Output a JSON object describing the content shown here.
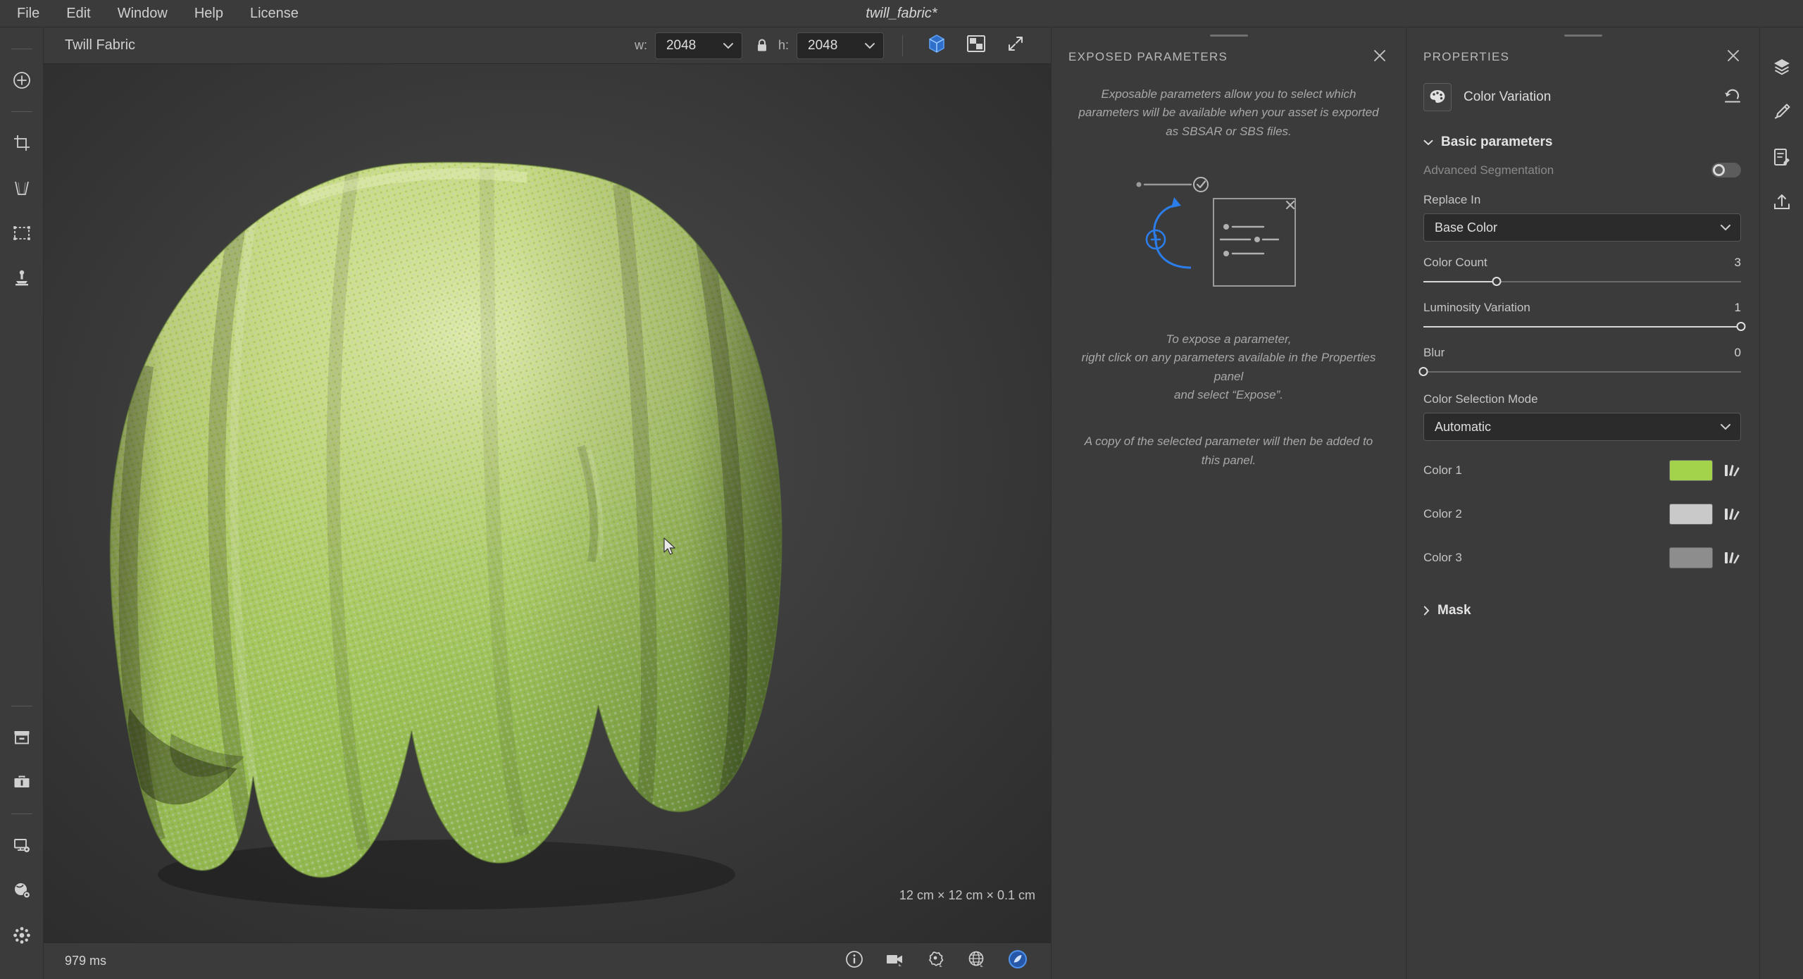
{
  "menubar": {
    "items": [
      "File",
      "Edit",
      "Window",
      "Help",
      "License"
    ],
    "document_title": "twill_fabric*"
  },
  "left_toolbar": {
    "tools": [
      {
        "name": "add-node-tool",
        "icon": "plus-circle-icon"
      },
      {
        "name": "crop-tool",
        "icon": "crop-icon"
      },
      {
        "name": "perspective-tool",
        "icon": "perspective-icon"
      },
      {
        "name": "selection-tool",
        "icon": "selection-box-icon"
      },
      {
        "name": "clone-stamp-tool",
        "icon": "clone-stamp-icon"
      },
      {
        "name": "library-tool",
        "icon": "archive-box-icon"
      },
      {
        "name": "toolbox-tool",
        "icon": "toolbox-icon"
      },
      {
        "name": "display-settings-tool",
        "icon": "monitor-gear-icon"
      },
      {
        "name": "environment-settings-tool",
        "icon": "sphere-gear-icon"
      },
      {
        "name": "plugins-tool",
        "icon": "hub-icon"
      }
    ]
  },
  "viewport": {
    "tab_label": "Twill Fabric",
    "width_label": "w:",
    "width_value": "2048",
    "height_label": "h:",
    "height_value": "2048",
    "lock_icon": "lock-closed-icon",
    "mode_3d_icon": "cube-3d-icon",
    "mode_2d_icon": "checkerboard-2d-icon",
    "expand_icon": "expand-arrows-icon",
    "dimensions": "12 cm × 12 cm × 0.1 cm",
    "accent_color": "#3b7fd4"
  },
  "statusbar": {
    "render_time": "979 ms",
    "icons": [
      {
        "name": "info-icon"
      },
      {
        "name": "camera-icon"
      },
      {
        "name": "material-icon"
      },
      {
        "name": "environment-icon"
      },
      {
        "name": "tonemapping-icon"
      }
    ]
  },
  "exposed_parameters": {
    "title": "EXPOSED PARAMETERS",
    "close_icon": "close-icon",
    "description": "Exposable parameters allow you to select which parameters will be available when your asset is exported as SBSAR or SBS files.",
    "hint_1": "To expose a parameter,\nright click on any parameters available in the Properties panel\nand select “Expose”.",
    "hint_2": "A copy of the selected parameter will then be added to this panel.",
    "illustration_accent": "#2b7de9"
  },
  "properties": {
    "title": "PROPERTIES",
    "close_icon": "close-icon",
    "node_icon": "color-palette-icon",
    "node_name": "Color Variation",
    "reset_icon": "reset-arrow-icon",
    "sections": {
      "basic": {
        "label": "Basic parameters",
        "expanded": true,
        "advanced_segmentation": {
          "label": "Advanced Segmentation",
          "enabled": false,
          "disabled": true
        },
        "replace_in": {
          "label": "Replace In",
          "value": "Base Color"
        },
        "sliders": [
          {
            "label": "Color Count",
            "value": "3",
            "percent": 23
          },
          {
            "label": "Luminosity Variation",
            "value": "1",
            "percent": 100
          },
          {
            "label": "Blur",
            "value": "0",
            "percent": 0
          }
        ],
        "color_selection_mode": {
          "label": "Color Selection Mode",
          "value": "Automatic"
        },
        "colors": [
          {
            "label": "Color 1",
            "hex": "#a3d24b",
            "picker_icon": "color-picker-icon"
          },
          {
            "label": "Color 2",
            "hex": "#c9c9c9",
            "picker_icon": "color-picker-icon"
          },
          {
            "label": "Color 3",
            "hex": "#8d8d8d",
            "picker_icon": "color-picker-icon"
          }
        ]
      },
      "mask": {
        "label": "Mask",
        "expanded": false
      }
    }
  },
  "right_rail": {
    "items": [
      {
        "name": "layers-icon"
      },
      {
        "name": "brush-icon"
      },
      {
        "name": "properties-panel-icon"
      },
      {
        "name": "export-icon"
      }
    ]
  }
}
